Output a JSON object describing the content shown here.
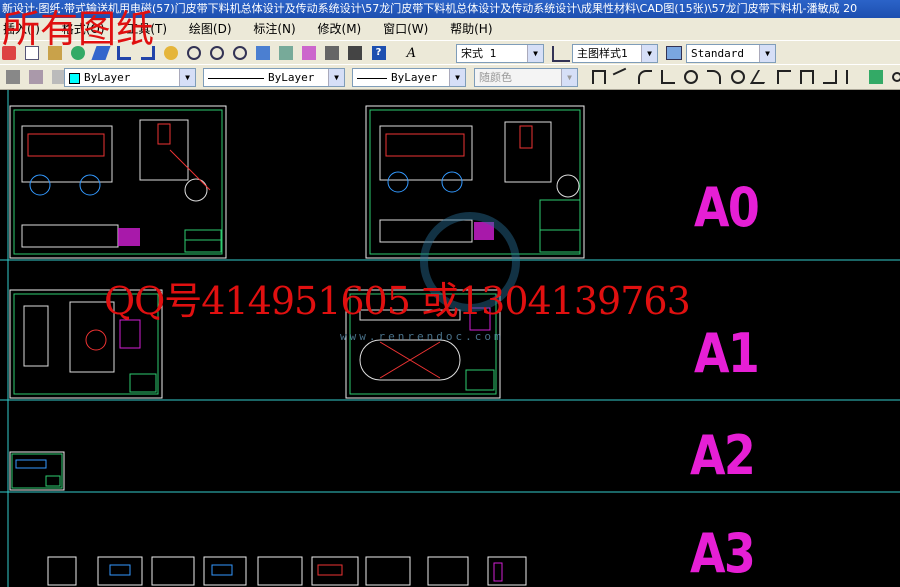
{
  "app": {
    "title": "新设计·图纸·带式输送机用电磁(57)门皮带下料机总体设计及传动系统设计\\57龙门皮带下料机总体设计及传动系统设计\\成果性材料\\CAD图(15张)\\57龙门皮带下料机-潘敏成 20"
  },
  "menu": {
    "items": [
      "插入(I)",
      "格式(O)",
      "工具(T)",
      "绘图(D)",
      "标注(N)",
      "修改(M)",
      "窗口(W)",
      "帮助(H)"
    ]
  },
  "toolbar": {
    "text_style": "宋式 1",
    "dim_style": "主图样式1",
    "table_style": "Standard",
    "layer": "ByLayer",
    "linetype": "ByLayer",
    "lineweight": "ByLayer",
    "plot_style": "随颜色"
  },
  "canvas": {
    "labels": [
      "A0",
      "A1",
      "A2",
      "A3"
    ],
    "accent": "#e61fd5",
    "grid_line_color": "#33cccc"
  },
  "watermark": {
    "top_text": "所有图纸",
    "qq_text": "QQ号414951605 或1304139763",
    "site_text": "www.renrendoc.com"
  }
}
